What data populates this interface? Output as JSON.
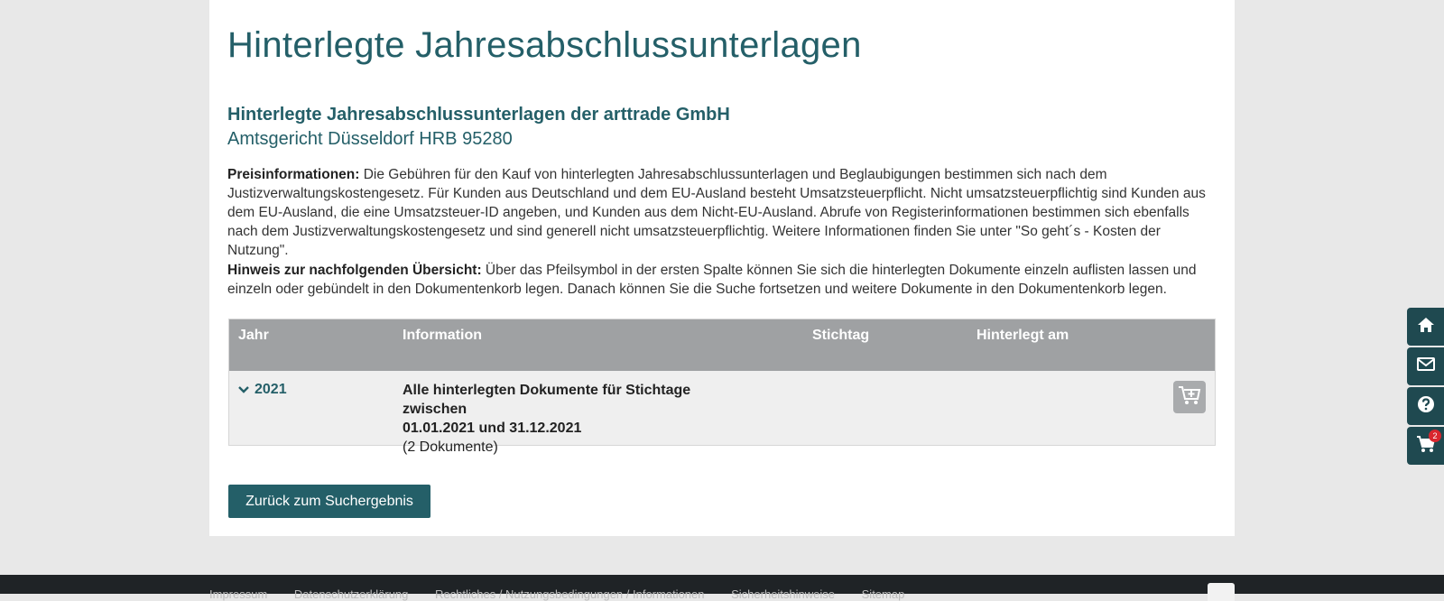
{
  "page": {
    "title": "Hinterlegte Jahresabschlussunterlagen",
    "company_title": "Hinterlegte Jahresabschlussunterlagen der arttrade GmbH",
    "court_line": "Amtsgericht Düsseldorf HRB 95280"
  },
  "info": {
    "price_label": "Preisinformationen:",
    "price_text": " Die Gebühren für den Kauf von hinterlegten Jahresabschlussunterlagen und Beglaubigungen bestimmen sich nach dem Justizverwaltungskostengesetz. Für Kunden aus Deutschland und dem EU-Ausland besteht Umsatzsteuerpflicht. Nicht umsatzsteuerpflichtig sind Kunden aus dem EU-Ausland, die eine Umsatzsteuer-ID angeben, und Kunden aus dem Nicht-EU-Ausland. Abrufe von Registerinformationen bestimmen sich ebenfalls nach dem Justizverwaltungskostengesetz und sind generell nicht umsatzsteuerpflichtig. Weitere Informationen finden Sie unter \"So geht´s - Kosten der Nutzung\".",
    "hint_label": "Hinweis zur nachfolgenden Übersicht:",
    "hint_text": " Über das Pfeilsymbol in der ersten Spalte können Sie sich die hinterlegten Dokumente einzeln auflisten lassen und einzeln oder gebündelt in den Dokumentenkorb legen. Danach können Sie die Suche fortsetzen und weitere Dokumente in den Dokumentenkorb legen."
  },
  "table": {
    "headers": [
      "Jahr",
      "Information",
      "Stichtag",
      "Hinterlegt am"
    ],
    "rows": [
      {
        "year": "2021",
        "info_line1": "Alle hinterlegten Dokumente für Stichtage zwischen",
        "info_line2": "01.01.2021 und 31.12.2021",
        "info_count": "(2 Dokumente)"
      }
    ]
  },
  "back_button": "Zurück zum Suchergebnis",
  "sidebar": {
    "icons": [
      "home-icon",
      "mail-icon",
      "help-icon",
      "cart-icon"
    ],
    "cart_badge": "2"
  },
  "footer": {
    "links": [
      "Impressum",
      "Datenschutzerklärung",
      "Rechtliches / Nutzungsbedingungen / Informationen",
      "Sicherheitshinweise",
      "Sitemap"
    ]
  },
  "colors": {
    "accent": "#245f68",
    "table_header": "#9fa1a3",
    "sidebar": "#1f4950",
    "footer": "#1f2326"
  }
}
